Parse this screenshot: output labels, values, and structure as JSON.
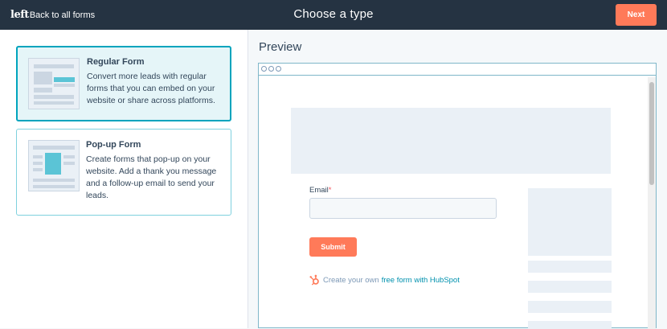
{
  "topbar": {
    "back_glyph": "left",
    "back_label": "Back to all forms",
    "title": "Choose a type",
    "next_label": "Next"
  },
  "form_types": [
    {
      "title": "Regular Form",
      "description": "Convert more leads with regular forms that you can embed on your website or share across platforms.",
      "selected": true
    },
    {
      "title": "Pop-up Form",
      "description": "Create forms that pop-up on your website. Add a thank you message and a follow-up email to send your leads.",
      "selected": false
    }
  ],
  "preview": {
    "label": "Preview",
    "email_label": "Email",
    "required_marker": "*",
    "submit_label": "Submit",
    "powered_prefix": "Create your own",
    "powered_link": "free form with HubSpot"
  },
  "colors": {
    "topbar": "#253342",
    "accent_orange": "#ff7a59",
    "selected_border": "#00a4bd",
    "link": "#0091ae"
  }
}
